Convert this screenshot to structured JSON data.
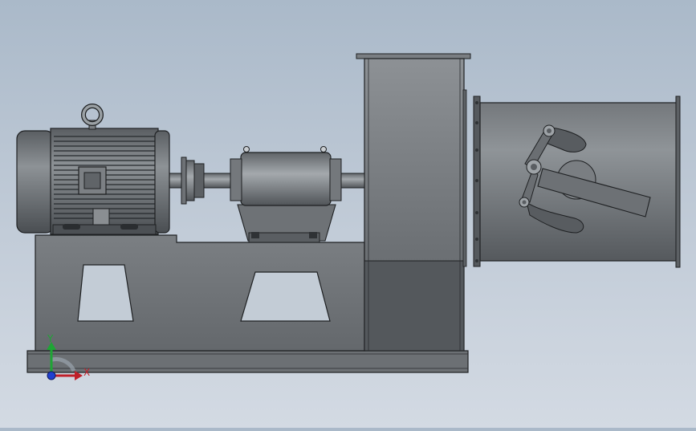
{
  "viewport": {
    "background_top": "#aab9c9",
    "background_bottom": "#d3dae3"
  },
  "triad": {
    "x_label": "X",
    "y_label": "Y",
    "x_color": "#c0202a",
    "y_color": "#1ea535",
    "z_color": "#2040d0"
  },
  "model": {
    "parts": [
      "base-frame",
      "motor",
      "eye-bolt",
      "coupling",
      "bearing-housing",
      "shaft",
      "fan-housing",
      "outlet-duct",
      "damper-linkage"
    ],
    "body_color": "#6f7478",
    "edge_color": "#202325"
  }
}
